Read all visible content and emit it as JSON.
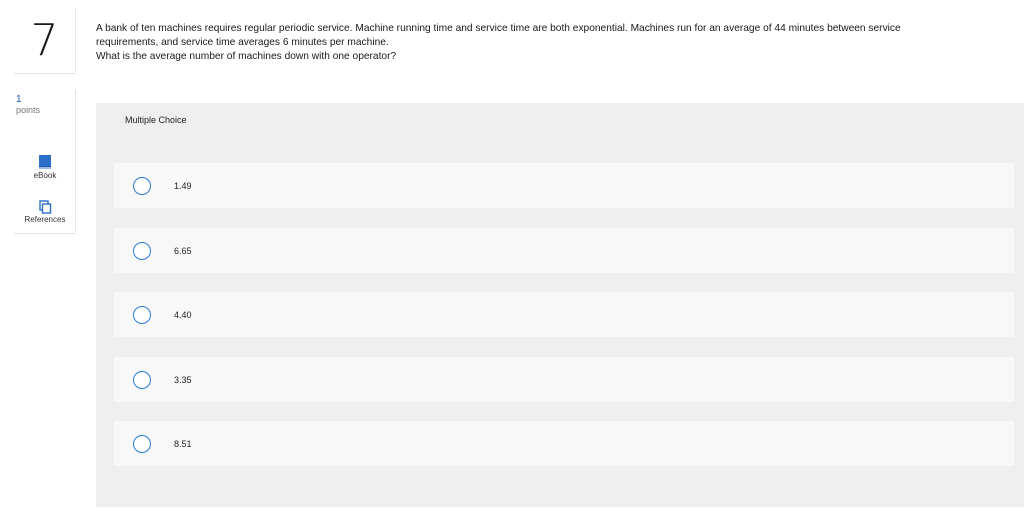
{
  "question": {
    "number": "7",
    "points_value": "1",
    "points_label": "points",
    "text_line1": "A bank of ten machines requires regular periodic service. Machine running time and service time are both exponential. Machines run for an average of 44 minutes between service",
    "text_line2": "requirements, and service time averages 6 minutes per machine.",
    "text_line3": "What is the average number of machines down with one operator?"
  },
  "tools": {
    "ebook_label": "eBook",
    "references_label": "References",
    "ebook_icon": "book-icon",
    "references_icon": "documents-icon",
    "icon_color": "#2a6fc9"
  },
  "multiple_choice": {
    "header": "Multiple Choice",
    "options": [
      {
        "label": "1.49"
      },
      {
        "label": "6.65"
      },
      {
        "label": "4.40"
      },
      {
        "label": "3.35"
      },
      {
        "label": "8.51"
      }
    ]
  },
  "colors": {
    "panel_bg": "#efefef",
    "option_bg": "#f8f8f8",
    "radio_border": "#2a7bd4"
  }
}
